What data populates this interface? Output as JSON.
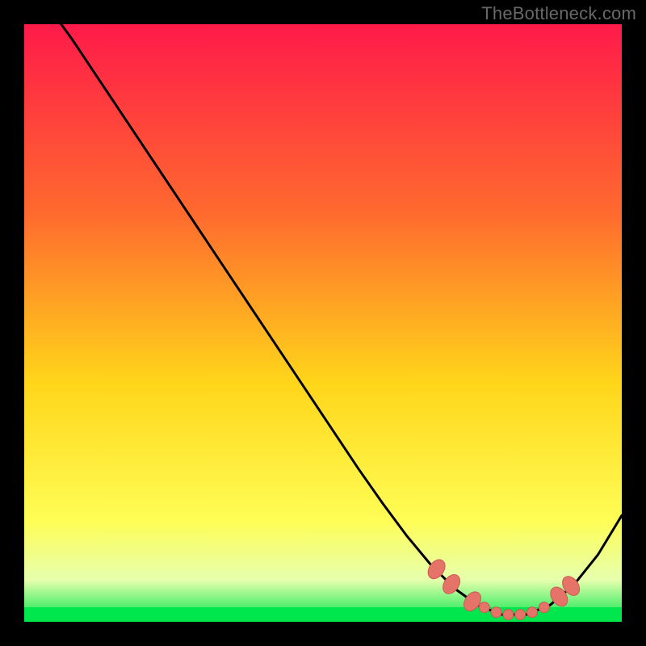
{
  "watermark": "TheBottleneck.com",
  "colors": {
    "top": "#ff1a4a",
    "mid1": "#ff6b2e",
    "mid2": "#ffd61a",
    "mid3": "#fffd55",
    "bottomband_light": "#e6ffad",
    "bottom": "#00e64d",
    "curve": "#000000",
    "marker_fill": "#e57368",
    "marker_stroke": "#c95c53"
  },
  "chart_data": {
    "type": "line",
    "title": "",
    "xlabel": "",
    "ylabel": "",
    "xlim": [
      0,
      100
    ],
    "ylim": [
      0,
      100
    ],
    "grid": false,
    "legend": false,
    "x": [
      0,
      4,
      8,
      12,
      16,
      20,
      24,
      28,
      32,
      36,
      40,
      44,
      48,
      52,
      56,
      60,
      64,
      68,
      72,
      76,
      80,
      84,
      88,
      92,
      96,
      100
    ],
    "series": [
      {
        "name": "bottleneck-curve",
        "values": [
          108,
          103,
          97.5,
          91.5,
          85.5,
          79.5,
          73.5,
          67.5,
          61.5,
          55.5,
          49.5,
          43.5,
          37.5,
          31.5,
          25.5,
          19.8,
          14.4,
          9.6,
          5.6,
          2.7,
          1.2,
          1.2,
          2.8,
          6.2,
          11.2,
          17.8
        ]
      }
    ],
    "markers": {
      "name": "highlighted-range",
      "points": [
        {
          "x": 69,
          "y": 8.8
        },
        {
          "x": 71.5,
          "y": 6.3
        },
        {
          "x": 75,
          "y": 3.4
        },
        {
          "x": 77,
          "y": 2.4
        },
        {
          "x": 79,
          "y": 1.6
        },
        {
          "x": 81,
          "y": 1.2
        },
        {
          "x": 83,
          "y": 1.2
        },
        {
          "x": 85,
          "y": 1.6
        },
        {
          "x": 87,
          "y": 2.4
        },
        {
          "x": 89.5,
          "y": 4.2
        },
        {
          "x": 91.5,
          "y": 6.0
        }
      ]
    }
  }
}
